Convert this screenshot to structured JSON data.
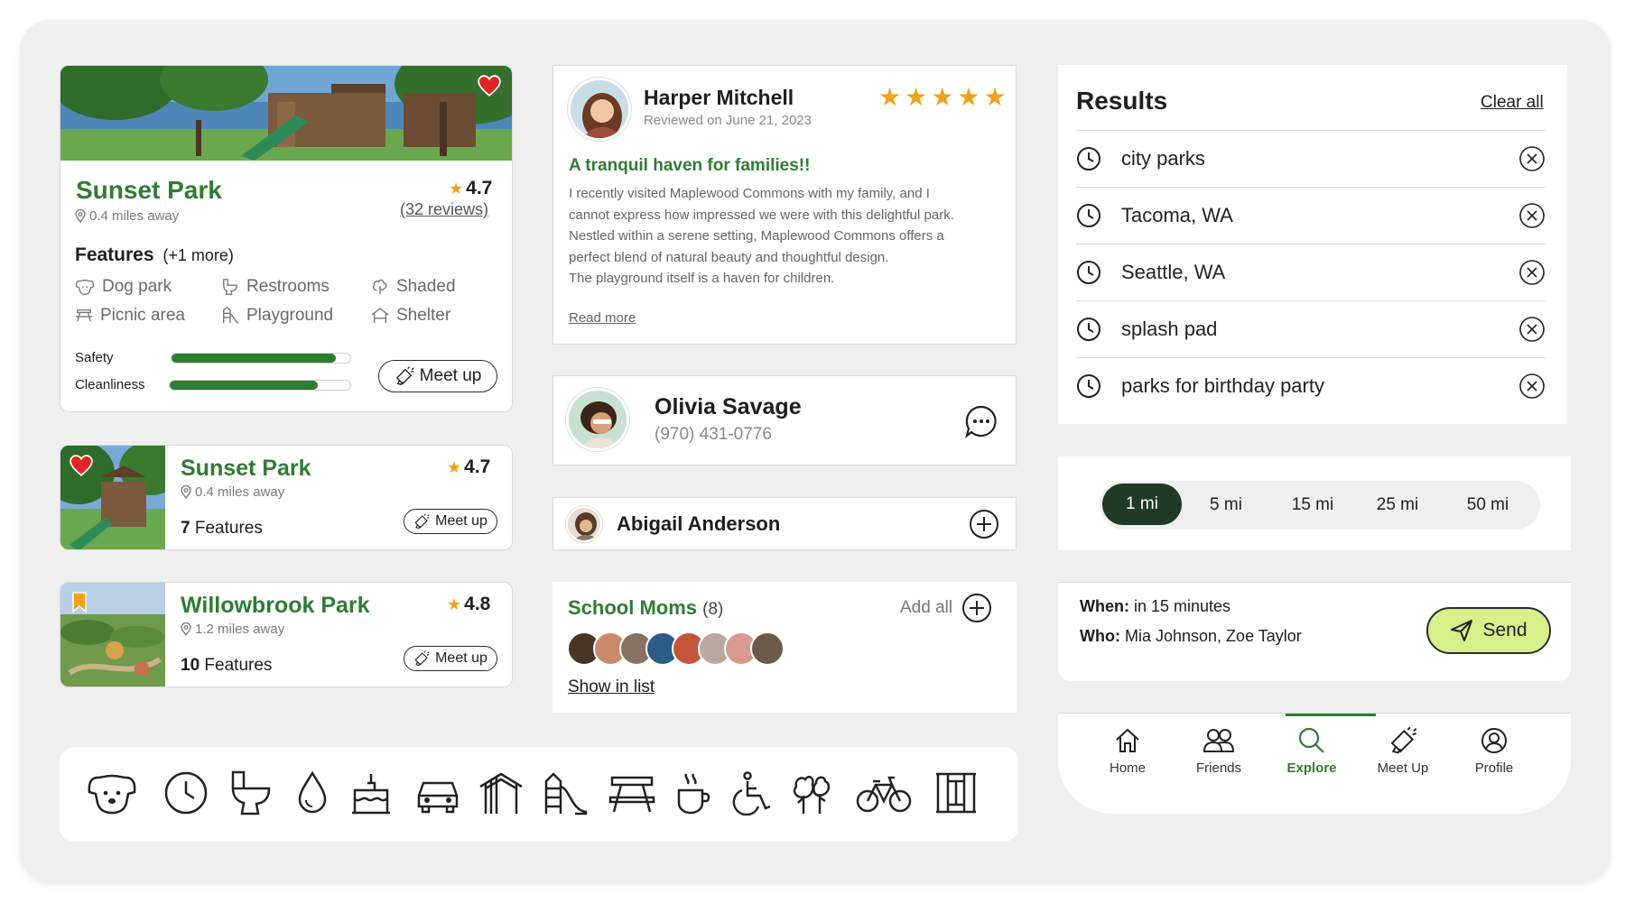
{
  "park_card_main": {
    "name": "Sunset Park",
    "distance": "0.4 miles away",
    "rating": "4.7",
    "reviews": "(32 reviews)",
    "features_title": "Features",
    "features_more": "(+1 more)",
    "features": [
      {
        "label": "Dog park",
        "icon": "dog-icon"
      },
      {
        "label": "Restrooms",
        "icon": "toilet-icon"
      },
      {
        "label": "Shaded",
        "icon": "tree-icon"
      },
      {
        "label": "Picnic area",
        "icon": "picnic-table-icon"
      },
      {
        "label": "Playground",
        "icon": "slide-icon"
      },
      {
        "label": "Shelter",
        "icon": "shelter-icon"
      }
    ],
    "safety_label": "Safety",
    "safety_value": 0.92,
    "cleanliness_label": "Cleanliness",
    "cleanliness_value": 0.82,
    "meet_up_label": "Meet up"
  },
  "park_list": [
    {
      "name": "Sunset Park",
      "distance": "0.4 miles away",
      "rating": "4.7",
      "features_count": "7",
      "features_label": "Features",
      "meet_up_label": "Meet up",
      "badge": "heart-icon"
    },
    {
      "name": "Willowbrook Park",
      "distance": "1.2 miles away",
      "rating": "4.8",
      "features_count": "10",
      "features_label": "Features",
      "meet_up_label": "Meet up",
      "badge": "bookmark-icon"
    }
  ],
  "review": {
    "author": "Harper Mitchell",
    "date": "Reviewed on June 21, 2023",
    "stars": 5,
    "title": "A tranquil haven for families!!",
    "lines": [
      "I recently visited Maplewood Commons with my family, and I",
      "cannot express how impressed we were with this delightful park.",
      "Nestled within a serene setting, Maplewood Commons offers a",
      "perfect blend of natural beauty and thoughtful design.",
      "The playground itself is a haven for children."
    ],
    "read_more": "Read more"
  },
  "contact": {
    "name": "Olivia Savage",
    "phone": "(970) 431-0776"
  },
  "friend": {
    "name": "Abigail Anderson"
  },
  "group": {
    "name": "School Moms",
    "count": "(8)",
    "add_all": "Add all",
    "show_list": "Show in list"
  },
  "results": {
    "title": "Results",
    "clear_all": "Clear all",
    "items": [
      "city parks",
      "Tacoma, WA",
      "Seattle, WA",
      "splash pad",
      "parks for birthday party"
    ]
  },
  "distance_options": [
    "1 mi",
    "5 mi",
    "15 mi",
    "25 mi",
    "50 mi"
  ],
  "distance_selected": "1 mi",
  "invite": {
    "when_label": "When:",
    "when_value": "in 15 minutes",
    "who_label": "Who:",
    "who_value": "Mia Johnson, Zoe Taylor",
    "send_label": "Send"
  },
  "nav": {
    "items": [
      {
        "label": "Home",
        "icon": "home-icon"
      },
      {
        "label": "Friends",
        "icon": "friends-icon"
      },
      {
        "label": "Explore",
        "icon": "search-icon"
      },
      {
        "label": "Meet Up",
        "icon": "megaphone-icon"
      },
      {
        "label": "Profile",
        "icon": "profile-icon"
      }
    ],
    "active": "Explore"
  },
  "amenity_icons": [
    "dog-icon",
    "clock-icon",
    "toilet-icon",
    "water-drop-icon",
    "cake-icon",
    "car-icon",
    "shelter-icon",
    "slide-icon",
    "picnic-table-icon",
    "coffee-icon",
    "wheelchair-icon",
    "trees-icon",
    "bicycle-icon",
    "fence-icon"
  ],
  "colors": {
    "brand_green": "#2f7d32",
    "accent_lime": "#d7f08a",
    "dark_pill": "#1f3a26",
    "heart_red": "#e02424",
    "star_gold": "#f0a21b"
  }
}
